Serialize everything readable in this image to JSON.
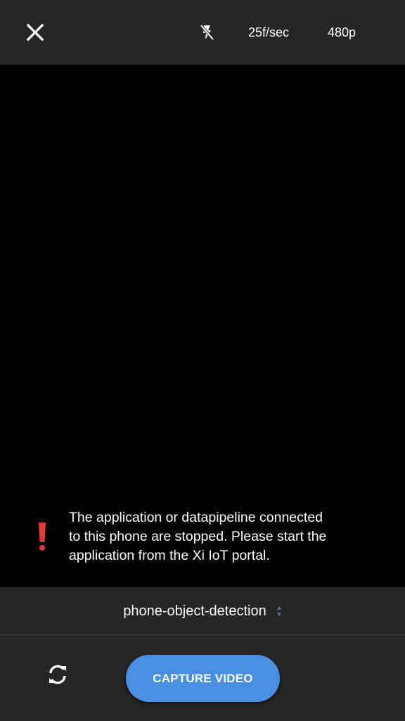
{
  "top_bar": {
    "close_icon": "close-icon",
    "flash_icon": "flash-off-icon",
    "frame_rate": "25f/sec",
    "resolution": "480p"
  },
  "alert": {
    "icon": "exclamation-icon",
    "icon_color": "#e53935",
    "lines": [
      "The application or datapipeline connected",
      "to this phone are stopped. Please start the",
      "application from the Xi IoT portal."
    ]
  },
  "selector": {
    "value": "phone-object-detection",
    "icon": "select-arrows-icon"
  },
  "bottom_bar": {
    "switch_camera_icon": "switch-camera-icon",
    "capture_label": "CAPTURE VIDEO",
    "capture_color": "#4a90e2"
  }
}
